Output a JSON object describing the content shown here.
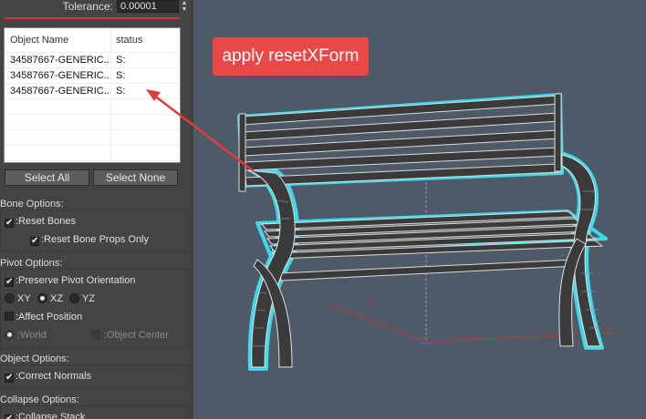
{
  "tolerance": {
    "label": "Tolerance:",
    "value": "0.00001"
  },
  "object_list": {
    "columns": [
      "Object Name",
      "status"
    ],
    "rows": [
      {
        "name": "34587667-GENERIC...",
        "status": "S:"
      },
      {
        "name": "34587667-GENERIC...",
        "status": "S:"
      },
      {
        "name": "34587667-GENERIC...",
        "status": "S:"
      }
    ]
  },
  "buttons": {
    "select_all": "Select All",
    "select_none": "Select None"
  },
  "bone_options": {
    "title": "Bone Options:",
    "reset_bones": ":Reset Bones",
    "reset_bone_props": ":Reset Bone Props Only"
  },
  "pivot_options": {
    "title": "Pivot Options:",
    "preserve": ":Preserve Pivot Orientation",
    "xy": "XY",
    "xz": "XZ",
    "yz": "YZ",
    "affect_position": ":Affect Position",
    "world": ":World",
    "object_center": ":Object Center"
  },
  "object_options": {
    "title": "Object Options:",
    "correct_normals": ":Correct Normals"
  },
  "collapse_options": {
    "title": "Collapse Options:",
    "collapse_stack": ":Collapse Stack"
  },
  "viewport": {
    "callout": "apply resetXForm"
  },
  "colors": {
    "accent_red": "#c8372b",
    "callout": "#ea4747",
    "selection": "#3fd9ea",
    "viewport_bg": "#4f5a69"
  },
  "icons": {
    "check": "✔",
    "spinner_up": "▲",
    "spinner_down": "▼"
  }
}
